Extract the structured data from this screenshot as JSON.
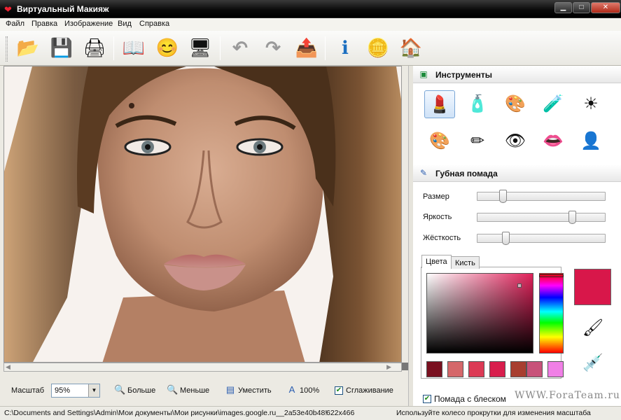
{
  "window": {
    "title": "Виртуальный Макияж",
    "controls": {
      "minimize": "▁",
      "maximize": "□",
      "close": "✕"
    }
  },
  "menu": [
    "Файл",
    "Правка",
    "Изображение",
    "Вид",
    "Справка"
  ],
  "toolbar": {
    "buttons": [
      {
        "name": "open-icon",
        "glyph": "📂"
      },
      {
        "name": "save-icon",
        "glyph": "💾"
      },
      {
        "name": "print-icon",
        "glyph": "🖨"
      },
      {
        "name": "book-icon",
        "glyph": "📖"
      },
      {
        "name": "smiley-icon",
        "glyph": "😊"
      },
      {
        "name": "monitor-icon",
        "glyph": "🖥"
      },
      {
        "name": "undo-icon",
        "glyph": "↶"
      },
      {
        "name": "redo-icon",
        "glyph": "↷"
      },
      {
        "name": "export-icon",
        "glyph": "📤"
      },
      {
        "name": "info-icon",
        "glyph": "ℹ"
      },
      {
        "name": "coins-icon",
        "glyph": "🪙"
      },
      {
        "name": "home-icon",
        "glyph": "🏠"
      }
    ]
  },
  "zoom": {
    "label": "Масштаб",
    "value": "95%",
    "zoom_in": "Больше",
    "zoom_out": "Меньше",
    "fit": "Уместить",
    "actual": "100%",
    "smoothing": "Сглаживание",
    "smoothing_checked": true
  },
  "tools_panel": {
    "title": "Инструменты",
    "tools": [
      {
        "name": "lipstick-tool-icon",
        "glyph": "💄",
        "selected": true
      },
      {
        "name": "powder-tool-icon",
        "glyph": "🧴",
        "selected": false
      },
      {
        "name": "blush-palette-tool-icon",
        "glyph": "🎨",
        "selected": false
      },
      {
        "name": "foundation-tool-icon",
        "glyph": "🧪",
        "selected": false
      },
      {
        "name": "tanning-tool-icon",
        "glyph": "☀",
        "selected": false
      },
      {
        "name": "eyeshadow-tool-icon",
        "glyph": "🎨",
        "selected": false
      },
      {
        "name": "pencil-tool-icon",
        "glyph": "✏",
        "selected": false
      },
      {
        "name": "eye-tool-icon",
        "glyph": "👁",
        "selected": false
      },
      {
        "name": "lips-tool-icon",
        "glyph": "👄",
        "selected": false
      },
      {
        "name": "hair-tool-icon",
        "glyph": "👤",
        "selected": false
      }
    ]
  },
  "lipstick_panel": {
    "title": "Губная помада",
    "params": [
      {
        "label": "Размер",
        "level": 0.2
      },
      {
        "label": "Яркость",
        "level": 0.74
      },
      {
        "label": "Жёсткость",
        "level": 0.22
      }
    ],
    "tabs": [
      "Цвета",
      "Кисть"
    ],
    "active_tab": 0,
    "selected_color": "#d8174a",
    "swatches": [
      "#7a1020",
      "#d5676a",
      "#dc3a55",
      "#d81d4c",
      "#a83e30",
      "#c8527a",
      "#f07fe6"
    ],
    "gloss_label": "Помада с блеском",
    "gloss_checked": true
  },
  "status": {
    "path": "C:\\Documents and Settings\\Admin\\Мои документы\\Мои рисунки\\images.google.ru__2a53e40b48!",
    "size": "622x466",
    "hint": "Используйте колесо прокрутки для изменения масштаба"
  },
  "watermark": "WWW.ForaTeam.ru"
}
